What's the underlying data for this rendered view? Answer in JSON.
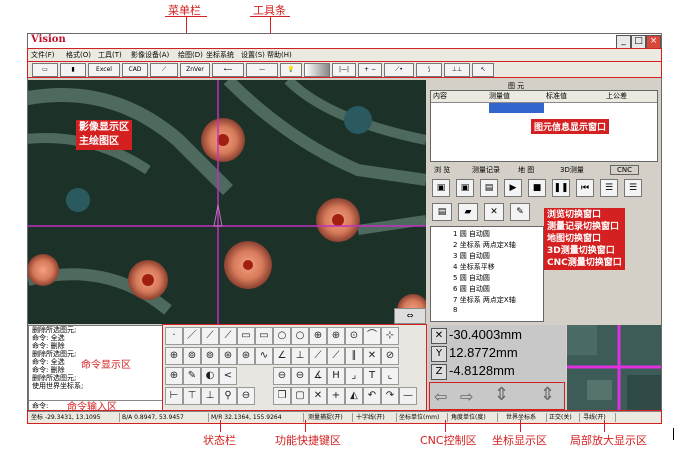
{
  "annotations": {
    "menubar": "菜单栏",
    "toolbar": "工具条",
    "image_area": "影像显示区",
    "image_area2": "主绘图区",
    "figure_info": "图元信息显示窗口",
    "switch_lines": [
      "浏览切换窗口",
      "测量记录切换窗口",
      "地图切换窗口",
      "3D测量切换窗口",
      "CNC测量切换窗口"
    ],
    "cmd_display": "命令显示区",
    "cmd_input": "命令输入区",
    "statusbar": "状态栏",
    "hotkeys": "功能快捷键区",
    "cnc": "CNC控制区",
    "coord_area": "坐标显示区",
    "zoom_area": "局部放大显示区"
  },
  "app": {
    "title": "Vision",
    "menu": [
      "文件(F)",
      "格式(O)",
      "工具(T)",
      "影像设备(A)",
      "绘图(D)",
      "坐标系统",
      "设置(S)",
      "帮助(H)"
    ],
    "toolbar": [
      "",
      "",
      "Excel",
      "CAD",
      "",
      "ZnVer",
      "",
      "",
      "",
      "",
      "",
      "",
      "",
      "",
      "",
      ""
    ]
  },
  "figure_panel": {
    "title": "图 元",
    "columns": [
      "内容",
      "测量值",
      "标准值",
      "上公差"
    ]
  },
  "tabs": [
    "浏 览",
    "测量记录",
    "地 图",
    "3D测量",
    "CNC"
  ],
  "records": [
    {
      "idx": "1",
      "text": "圆  自动圆"
    },
    {
      "idx": "2",
      "text": "坐标系  两点定X轴"
    },
    {
      "idx": "3",
      "text": "圆  自动圆"
    },
    {
      "idx": "4",
      "text": "坐标系平移"
    },
    {
      "idx": "5",
      "text": "圆  自动圆"
    },
    {
      "idx": "6",
      "text": "圆  自动圆"
    },
    {
      "idx": "7",
      "text": "坐标系  两点定X轴"
    },
    {
      "idx": "8",
      "text": ""
    }
  ],
  "commands": [
    "删除所选图元;",
    "命令: 全选",
    "命令: 删除",
    "删除所选图元;",
    "命令: 全选",
    "命令: 删除",
    "删除所选图元;",
    "使用世界坐标系;"
  ],
  "command_prompt": "命令:",
  "coords": {
    "x": "-30.4003mm",
    "y": "12.8772mm",
    "z": "-4.8128mm"
  },
  "status": [
    "坐标 -29.3431, 13.1095",
    "B/A 0.8947, 53.9457",
    "M/R 32.1364, 155.9264",
    "测量捕捉(开)",
    "十字线(开)",
    "坐标单位(mm)",
    "角度单位(度)",
    "世界坐标系",
    "正交(关)",
    "寻线(开)"
  ]
}
